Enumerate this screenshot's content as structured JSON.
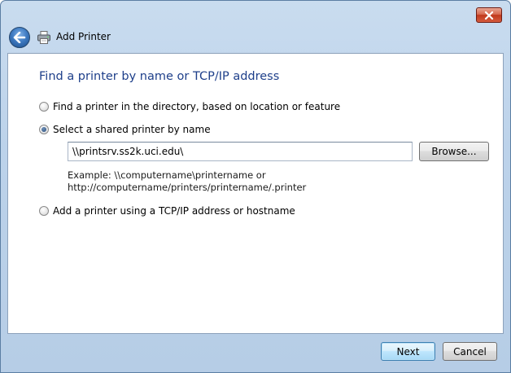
{
  "window": {
    "title": "Add Printer",
    "close_icon": "close-icon",
    "back_icon": "back-arrow-icon",
    "app_icon": "printer-icon"
  },
  "main": {
    "heading": "Find a printer by name or TCP/IP address",
    "options": [
      {
        "label": "Find a printer in the directory, based on location or feature",
        "selected": false
      },
      {
        "label": "Select a shared printer by name",
        "selected": true
      },
      {
        "label": "Add a printer using a TCP/IP address or hostname",
        "selected": false
      }
    ],
    "printer_name": {
      "value": "\\\\printsrv.ss2k.uci.edu\\"
    },
    "browse_label": "Browse...",
    "example_line1": "Example: \\\\computername\\printername or",
    "example_line2": "http://computername/printers/printername/.printer"
  },
  "footer": {
    "next_label": "Next",
    "cancel_label": "Cancel"
  },
  "colors": {
    "frame": "#bcd2ea",
    "heading": "#1e3f8a",
    "close_button": "#c0391c",
    "default_button_border": "#3c7fb1"
  }
}
